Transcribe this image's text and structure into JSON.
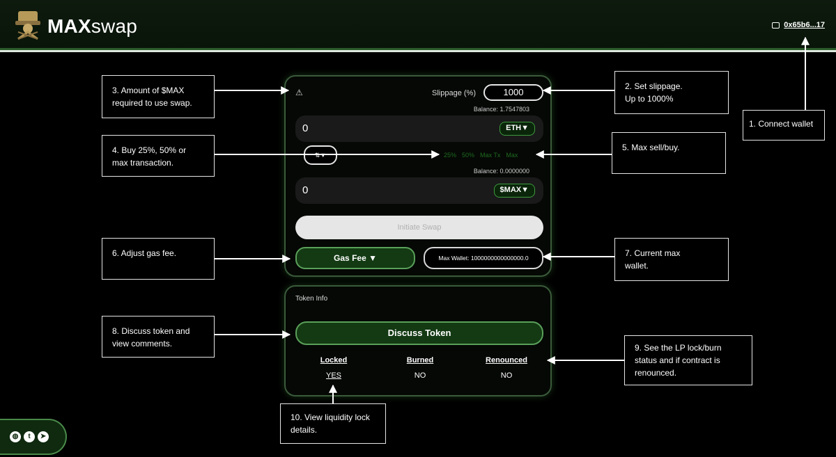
{
  "header": {
    "brand_bold": "MAX",
    "brand_light": "swap",
    "wallet_address": "0x65b6...17"
  },
  "swap": {
    "warning_icon": "warning-triangle-icon",
    "slippage_label": "Slippage (%)",
    "slippage_value": "1000",
    "from_balance": "Balance: 1.7547803",
    "from_amount": "0",
    "from_token": "ETH▼",
    "switch_label": "⇅▼",
    "percent_options": [
      "25%",
      "50%",
      "Max Tx",
      "Max"
    ],
    "to_balance": "Balance: 0.0000000",
    "to_amount": "0",
    "to_token": "$MAX▼",
    "initiate_label": "Initiate Swap",
    "gas_fee_label": "Gas Fee ▼",
    "max_wallet_label": "Max Wallet: 1000000000000000.0"
  },
  "token_info": {
    "title": "Token Info",
    "discuss_label": "Discuss Token",
    "locked_header": "Locked",
    "locked_value": "YES",
    "burned_header": "Burned",
    "burned_value": "NO",
    "renounced_header": "Renounced",
    "renounced_value": "NO"
  },
  "notes": {
    "n1": "1. Connect wallet",
    "n2": "2.  Set slippage.\nUp to 1000%",
    "n3": "3.  Amount of $MAX\nrequired to use swap.",
    "n4": "4.  Buy 25%, 50% or\nmax transaction.",
    "n5": "5.  Max sell/buy.",
    "n6": "6.  Adjust gas fee.",
    "n7": "7. Current max\nwallet.",
    "n8": "8. Discuss token and\nview comments.",
    "n9": "9. See the LP lock/burn\nstatus and if contract is\nrenounced.",
    "n10": "10. View liquidity lock\ndetails."
  },
  "social_icons": [
    "globe-icon",
    "twitter-icon",
    "telegram-icon"
  ],
  "colors": {
    "accent_green": "#133a13",
    "border_green": "#5aa05a",
    "background": "#000000"
  }
}
